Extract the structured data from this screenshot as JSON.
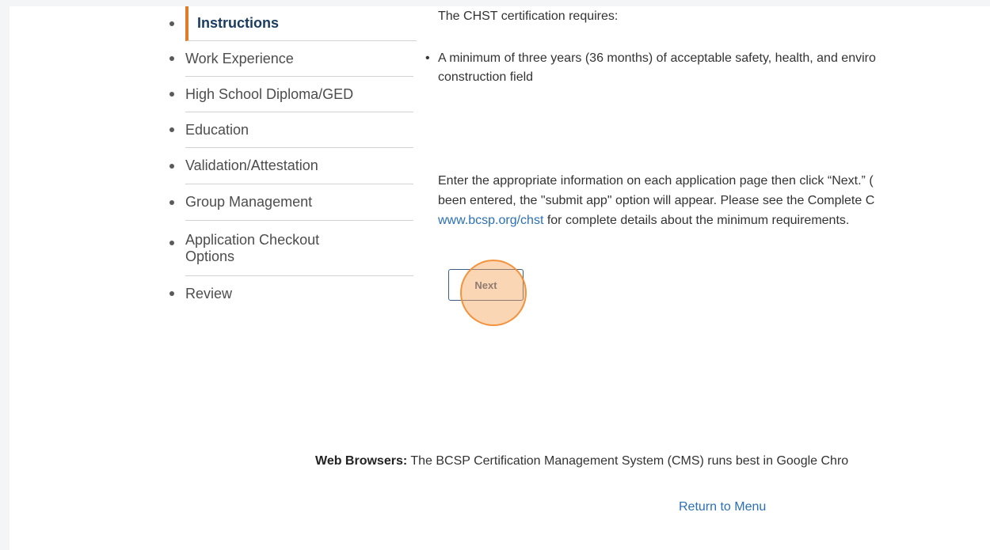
{
  "sidebar": {
    "items": [
      {
        "label": "Instructions"
      },
      {
        "label": "Work Experience"
      },
      {
        "label": "High School Diploma/GED"
      },
      {
        "label": "Education"
      },
      {
        "label": "Validation/Attestation"
      },
      {
        "label": "Group Management"
      },
      {
        "label": "Application Checkout"
      },
      {
        "label": "Options"
      },
      {
        "label": "Review"
      }
    ],
    "active_color": "#e07b27"
  },
  "main": {
    "intro": "The CHST certification requires:",
    "requirement_line1": "A minimum of three years (36 months) of acceptable safety, health, and enviro",
    "requirement_line2": "construction field",
    "info_line1": "Enter the appropriate information on each application page then click “Next.” (",
    "info_line2": "been entered, the \"submit app\" option will appear. Please see the Complete C",
    "info_link": "www.bcsp.org/chst",
    "info_line3_rest": " for complete details about the minimum requirements.",
    "next_label": "Next"
  },
  "footer": {
    "browsers_label": "Web Browsers:",
    "browsers_text": " The BCSP Certification Management System (CMS) runs best in Google Chro",
    "return_label": "Return to Menu"
  }
}
